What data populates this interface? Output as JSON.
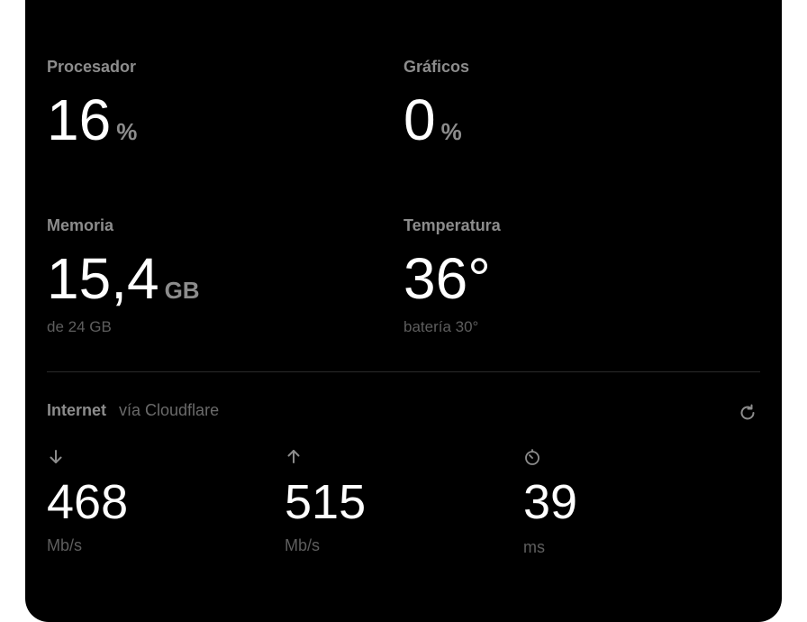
{
  "processor": {
    "label": "Procesador",
    "value": "16",
    "unit": "%"
  },
  "graphics": {
    "label": "Gráficos",
    "value": "0",
    "unit": "%"
  },
  "memory": {
    "label": "Memoria",
    "value": "15,4",
    "unit": "GB",
    "sub": "de 24 GB"
  },
  "temperature": {
    "label": "Temperatura",
    "value": "36°",
    "sub": "batería 30°"
  },
  "internet": {
    "title": "Internet",
    "source": "vía Cloudflare",
    "refresh_icon": "refresh-icon",
    "download": {
      "icon": "arrow-down-icon",
      "value": "468",
      "unit": "Mb/s"
    },
    "upload": {
      "icon": "arrow-up-icon",
      "value": "515",
      "unit": "Mb/s"
    },
    "latency": {
      "icon": "timer-icon",
      "value": "39",
      "unit": "ms"
    }
  },
  "colors": {
    "background": "#000000",
    "label": "#8c8c8c",
    "value": "#ffffff",
    "muted": "#5e5e5e"
  }
}
